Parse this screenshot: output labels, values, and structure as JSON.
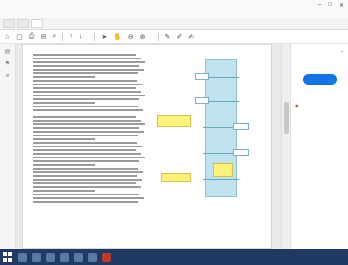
{
  "window": {
    "title": "",
    "controls": [
      "–",
      "□",
      "✕"
    ]
  },
  "menubar": {
    "items": []
  },
  "tabs": [
    {
      "label": ""
    },
    {
      "label": ""
    },
    {
      "label": "",
      "active": true
    }
  ],
  "toolbar": {
    "page_indicator": "",
    "zoom": ""
  },
  "document": {
    "left_heading": "",
    "section_heading": "",
    "figure_title": "",
    "figure_caption": "",
    "figure_labels": []
  },
  "right_panel": {
    "top_label": "",
    "items": [],
    "button_label": "",
    "bottom_label": "",
    "help_text": ""
  },
  "taskbar": {
    "tray_text": ""
  }
}
